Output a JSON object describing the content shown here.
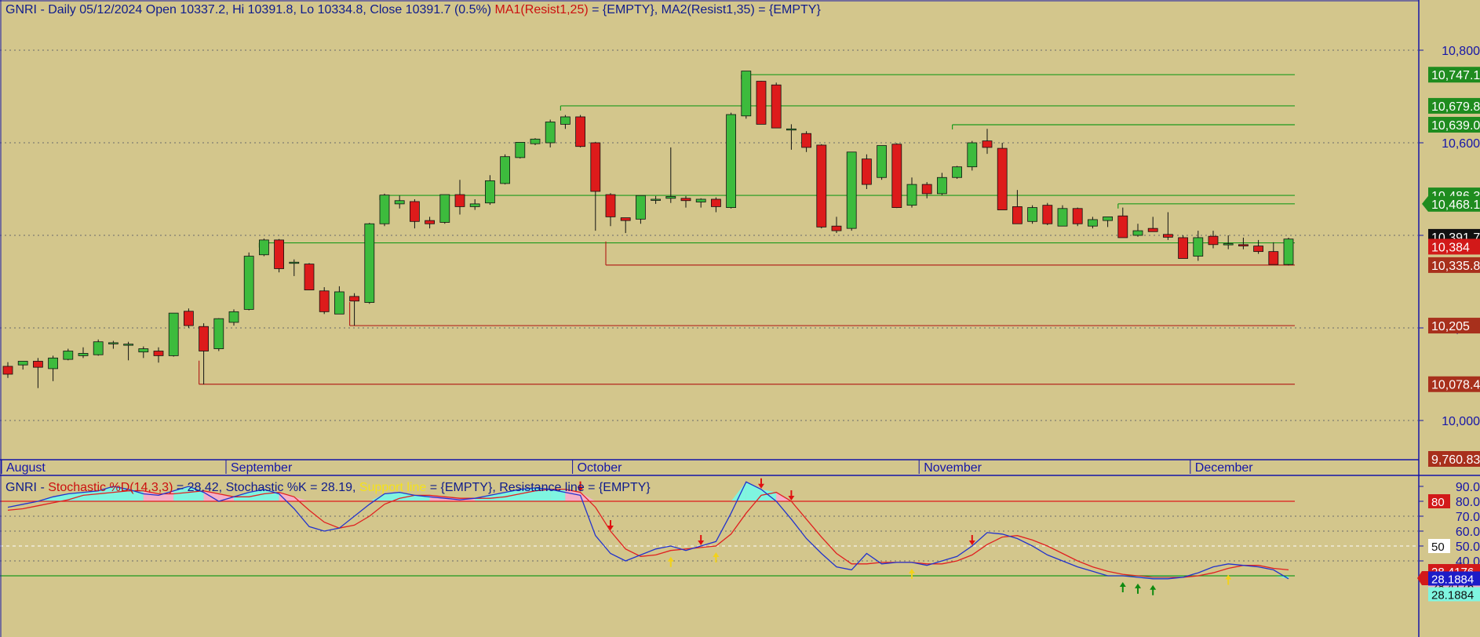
{
  "colors": {
    "background": "#d3c68c",
    "bull": "#3dbb3d",
    "bear": "#dd1b1b",
    "resistance": "#1c9a1c",
    "support": "#b3261e",
    "title": "#0f1c8c",
    "ma_label": "#cc1010",
    "support_label": "#f5e21a",
    "k_line": "#2233cc",
    "d_line": "#e02020",
    "fill_up": "#7ff5e0",
    "fill_down": "#f5b0c8",
    "axis": "#1515a8"
  },
  "header": {
    "main_text": "GNRI - Daily 05/12/2024 Open 10337.2, Hi 10391.8, Lo 10334.8, Close 10391.7 (0.5%)",
    "ma1": "MA1(Resist1,25)",
    "ma1_value": " = {EMPTY}, ",
    "ma2": "MA2(Resist1,35) = {EMPTY}"
  },
  "sub_header": {
    "prefix": "GNRI - ",
    "d_label": "Stochastic %D(14,3,3)",
    "d_value": " = 28.42, Stochastic %K = 28.19, ",
    "support": "Support line",
    "rest": " = {EMPTY}, Resistance line = {EMPTY}"
  },
  "chart_data": [
    {
      "type": "candlestick",
      "ylim": [
        9760.83,
        10850
      ],
      "y_ticks": [
        "10,800",
        "10,600",
        "10,400",
        "10,200",
        "10,000"
      ],
      "y_tick_values": [
        10800,
        10600,
        10400,
        10200,
        10000
      ],
      "months": [
        "August",
        "September",
        "October",
        "November",
        "December"
      ],
      "month_bar_index": [
        0,
        15,
        38,
        61,
        79
      ],
      "ohlc": [
        [
          10117,
          10126,
          10092,
          10100
        ],
        [
          10120,
          10128,
          10110,
          10128
        ],
        [
          10128,
          10135,
          10070,
          10115
        ],
        [
          10112,
          10140,
          10085,
          10135
        ],
        [
          10132,
          10155,
          10130,
          10150
        ],
        [
          10140,
          10158,
          10135,
          10145
        ],
        [
          10142,
          10175,
          10140,
          10170
        ],
        [
          10168,
          10172,
          10155,
          10168
        ],
        [
          10165,
          10170,
          10130,
          10165
        ],
        [
          10148,
          10160,
          10135,
          10155
        ],
        [
          10150,
          10158,
          10125,
          10140
        ],
        [
          10140,
          10232,
          10138,
          10232
        ],
        [
          10236,
          10242,
          10200,
          10205
        ],
        [
          10203,
          10210,
          10078,
          10150
        ],
        [
          10155,
          10221,
          10150,
          10220
        ],
        [
          10212,
          10240,
          10205,
          10235
        ],
        [
          10240,
          10363,
          10238,
          10355
        ],
        [
          10358,
          10393,
          10355,
          10390
        ],
        [
          10390,
          10392,
          10320,
          10328
        ],
        [
          10340,
          10348,
          10312,
          10342
        ],
        [
          10338,
          10340,
          10282,
          10282
        ],
        [
          10280,
          10288,
          10230,
          10235
        ],
        [
          10230,
          10290,
          10230,
          10278
        ],
        [
          10268,
          10275,
          10205,
          10258
        ],
        [
          10255,
          10427,
          10252,
          10425
        ],
        [
          10425,
          10490,
          10420,
          10487
        ],
        [
          10468,
          10486,
          10458,
          10475
        ],
        [
          10473,
          10478,
          10415,
          10430
        ],
        [
          10432,
          10440,
          10415,
          10425
        ],
        [
          10428,
          10485,
          10425,
          10488
        ],
        [
          10488,
          10520,
          10445,
          10462
        ],
        [
          10462,
          10478,
          10455,
          10468
        ],
        [
          10470,
          10530,
          10466,
          10518
        ],
        [
          10512,
          10575,
          10510,
          10570
        ],
        [
          10568,
          10600,
          10566,
          10601
        ],
        [
          10598,
          10610,
          10595,
          10608
        ],
        [
          10600,
          10650,
          10590,
          10645
        ],
        [
          10640,
          10660,
          10630,
          10656
        ],
        [
          10656,
          10660,
          10590,
          10592
        ],
        [
          10600,
          10602,
          10410,
          10495
        ],
        [
          10488,
          10491,
          10420,
          10440
        ],
        [
          10438,
          10438,
          10405,
          10432
        ],
        [
          10435,
          10485,
          10425,
          10486
        ],
        [
          10478,
          10485,
          10468,
          10478
        ],
        [
          10480,
          10590,
          10470,
          10484
        ],
        [
          10480,
          10485,
          10460,
          10475
        ],
        [
          10472,
          10480,
          10460,
          10478
        ],
        [
          10478,
          10482,
          10450,
          10462
        ],
        [
          10460,
          10665,
          10458,
          10661
        ],
        [
          10658,
          10750,
          10652,
          10755
        ],
        [
          10733,
          10734,
          10655,
          10640
        ],
        [
          10725,
          10730,
          10635,
          10632
        ],
        [
          10630,
          10640,
          10585,
          10630
        ],
        [
          10620,
          10625,
          10580,
          10590
        ],
        [
          10595,
          10597,
          10415,
          10418
        ],
        [
          10420,
          10440,
          10405,
          10410
        ],
        [
          10415,
          10570,
          10410,
          10580
        ],
        [
          10565,
          10575,
          10500,
          10510
        ],
        [
          10525,
          10590,
          10520,
          10594
        ],
        [
          10597,
          10599,
          10459,
          10460
        ],
        [
          10465,
          10525,
          10460,
          10510
        ],
        [
          10510,
          10515,
          10480,
          10490
        ],
        [
          10490,
          10535,
          10487,
          10525
        ],
        [
          10525,
          10550,
          10522,
          10548
        ],
        [
          10548,
          10604,
          10540,
          10600
        ],
        [
          10604,
          10630,
          10576,
          10590
        ],
        [
          10588,
          10600,
          10480,
          10455
        ],
        [
          10462,
          10498,
          10425,
          10425
        ],
        [
          10430,
          10465,
          10425,
          10460
        ],
        [
          10465,
          10470,
          10422,
          10425
        ],
        [
          10420,
          10465,
          10420,
          10458
        ],
        [
          10458,
          10460,
          10420,
          10425
        ],
        [
          10420,
          10440,
          10415,
          10434
        ],
        [
          10432,
          10438,
          10418,
          10440
        ],
        [
          10442,
          10460,
          10405,
          10395
        ],
        [
          10400,
          10425,
          10397,
          10410
        ],
        [
          10415,
          10440,
          10410,
          10408
        ],
        [
          10402,
          10450,
          10390,
          10396
        ],
        [
          10395,
          10400,
          10360,
          10350
        ],
        [
          10355,
          10410,
          10345,
          10395
        ],
        [
          10398,
          10410,
          10372,
          10380
        ],
        [
          10380,
          10400,
          10370,
          10382
        ],
        [
          10380,
          10395,
          10370,
          10377
        ],
        [
          10377,
          10390,
          10360,
          10365
        ],
        [
          10365,
          10385,
          10340,
          10337
        ],
        [
          10337,
          10395,
          10335,
          10392
        ]
      ],
      "resistance_levels": [
        {
          "price": 10747.1,
          "from": 49,
          "label": "10,747.1"
        },
        {
          "price": 10679.8,
          "from": 37,
          "label": "10,679.8"
        },
        {
          "price": 10639.0,
          "from": 63,
          "label": "10,639.0"
        },
        {
          "price": 10486.3,
          "from": 25,
          "label": "10,486.3"
        },
        {
          "price": 10468.1,
          "from": 74,
          "label": "10,468.1"
        },
        {
          "price": 10383.8,
          "from": 17,
          "label": "10,383.8"
        }
      ],
      "support_levels": [
        {
          "price": 10335.8,
          "from": 40,
          "label": "10,335.8"
        },
        {
          "price": 10205.0,
          "from": 23,
          "label": "10,205"
        },
        {
          "price": 10078.4,
          "from": 13,
          "label": "10,078.4"
        }
      ],
      "price_labels": [
        {
          "price": 10391.7,
          "label": "10,391.7",
          "kind": "current"
        },
        {
          "price": 10384.0,
          "label": "10,384",
          "kind": "red"
        },
        {
          "price": 9760.83,
          "label": "9,760.83",
          "kind": "bottom"
        }
      ]
    },
    {
      "type": "line",
      "title": "Stochastic %D(14,3,3)",
      "ylim": [
        25,
        95
      ],
      "y_ticks": [
        "90.0",
        "80.0",
        "70.0",
        "60.0",
        "50.0",
        "40.0",
        "30.0"
      ],
      "y_tick_values": [
        90,
        80,
        70,
        60,
        50,
        40,
        30
      ],
      "series": [
        {
          "name": "Stochastic %K",
          "values": [
            76,
            78,
            80,
            83,
            85,
            86,
            87,
            90,
            88,
            85,
            84,
            87,
            90,
            86,
            80,
            83,
            86,
            88,
            85,
            75,
            63,
            60,
            62,
            70,
            78,
            85,
            86,
            84,
            83,
            82,
            81,
            82,
            84,
            86,
            88,
            89,
            88,
            86,
            84,
            57,
            45,
            40,
            44,
            48,
            50,
            47,
            50,
            53,
            72,
            93,
            88,
            80,
            68,
            55,
            45,
            36,
            34,
            45,
            38,
            39,
            39,
            37,
            40,
            43,
            50,
            59,
            58,
            55,
            50,
            44,
            40,
            36,
            33,
            30,
            30,
            29,
            28,
            28,
            29,
            32,
            36,
            38,
            37,
            36,
            34,
            28
          ]
        },
        {
          "name": "Stochastic %D",
          "values": [
            74,
            75,
            77,
            79,
            81,
            84,
            85,
            86,
            87,
            87,
            85,
            85,
            86,
            87,
            85,
            83,
            83,
            85,
            86,
            83,
            74,
            66,
            62,
            64,
            70,
            78,
            82,
            84,
            84,
            83,
            82,
            82,
            82,
            83,
            85,
            87,
            88,
            88,
            86,
            76,
            60,
            48,
            43,
            44,
            47,
            48,
            49,
            50,
            58,
            72,
            84,
            86,
            80,
            68,
            56,
            45,
            38,
            38,
            39,
            39,
            39,
            38,
            38,
            40,
            44,
            51,
            56,
            57,
            54,
            50,
            45,
            40,
            36,
            33,
            31,
            30,
            29,
            29,
            29,
            30,
            32,
            35,
            37,
            37,
            35,
            34
          ]
        }
      ],
      "lines": {
        "overbought": 80,
        "oversold": 30,
        "middle": 50
      },
      "value_labels": [
        {
          "value": 80,
          "label": "80",
          "kind": "red"
        },
        {
          "value": 50,
          "label": "50",
          "kind": "white"
        },
        {
          "value": 28.4176,
          "label": "28.4176",
          "kind": "red"
        },
        {
          "value": 28.4176,
          "label": "28.4176",
          "kind": "pink"
        },
        {
          "value": 28.1884,
          "label": "28.1884",
          "kind": "blue"
        },
        {
          "value": 28.1884,
          "label": "28.1884",
          "kind": "cyan"
        }
      ],
      "sell_arrows": [
        38,
        40,
        46,
        50,
        52,
        64
      ],
      "buy_arrows_yellow": [
        44,
        47,
        60,
        81
      ],
      "buy_arrows_green": [
        74,
        75,
        76
      ]
    }
  ]
}
